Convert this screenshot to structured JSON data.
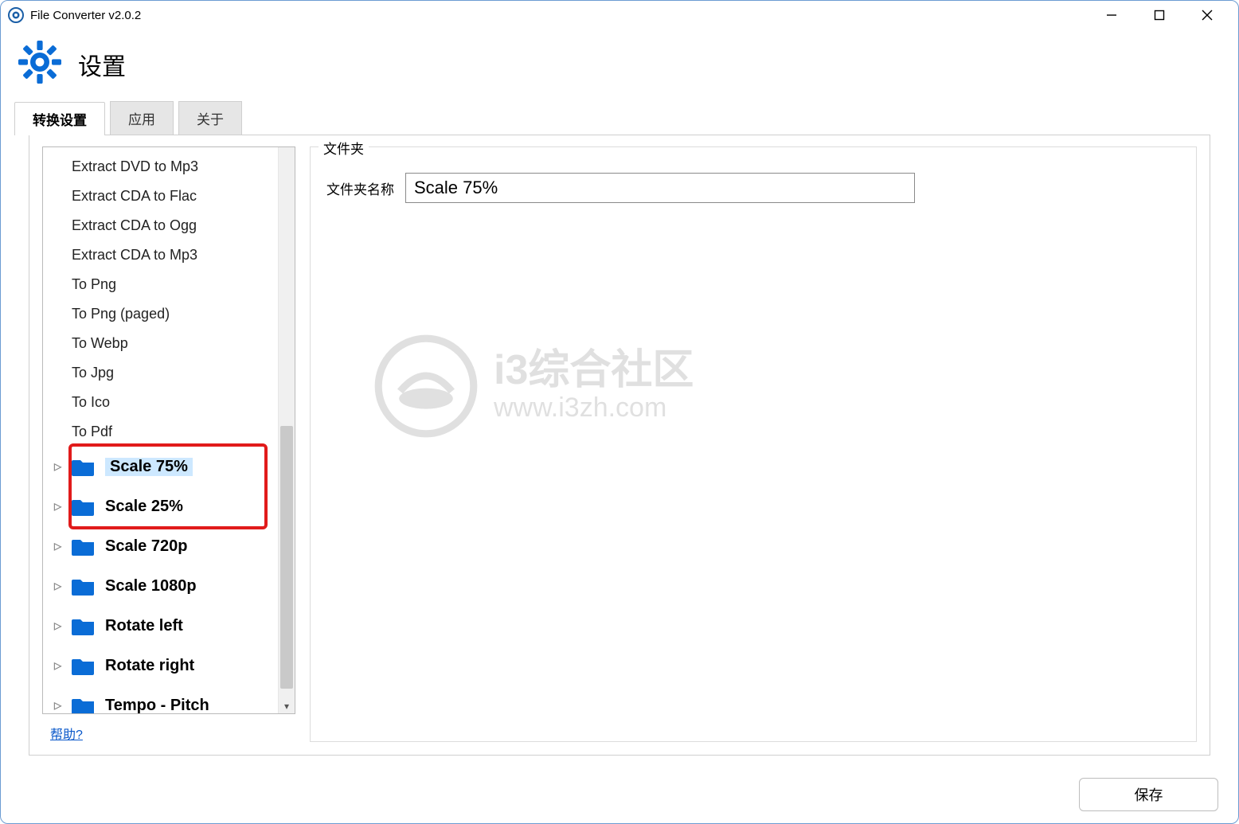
{
  "window": {
    "title": "File Converter v2.0.2"
  },
  "header": {
    "title": "设置"
  },
  "tabs": [
    {
      "label": "转换设置",
      "active": true
    },
    {
      "label": "应用",
      "active": false
    },
    {
      "label": "关于",
      "active": false
    }
  ],
  "tree": {
    "simple_items": [
      "Extract DVD to Mp3",
      "Extract CDA to Flac",
      "Extract CDA to Ogg",
      "Extract CDA to Mp3",
      "To Png",
      "To Png (paged)",
      "To Webp",
      "To Jpg",
      "To Ico",
      "To Pdf"
    ],
    "folders": [
      {
        "label": "Scale 75%",
        "selected": true,
        "highlighted": true
      },
      {
        "label": "Scale 25%",
        "selected": false,
        "highlighted": true
      },
      {
        "label": "Scale 720p",
        "selected": false,
        "highlighted": false
      },
      {
        "label": "Scale 1080p",
        "selected": false,
        "highlighted": false
      },
      {
        "label": "Rotate left",
        "selected": false,
        "highlighted": false
      },
      {
        "label": "Rotate right",
        "selected": false,
        "highlighted": false
      },
      {
        "label": "Tempo - Pitch",
        "selected": false,
        "highlighted": false
      }
    ]
  },
  "detail": {
    "fieldset_legend": "文件夹",
    "name_label": "文件夹名称",
    "name_value": "Scale 75%"
  },
  "help": {
    "label": "帮助?"
  },
  "buttons": {
    "save": "保存"
  },
  "watermark": {
    "line1": "i3综合社区",
    "line2": "www.i3zh.com"
  },
  "colors": {
    "accent": "#0a6cd6",
    "folder_icon": "#0a6cd6"
  }
}
